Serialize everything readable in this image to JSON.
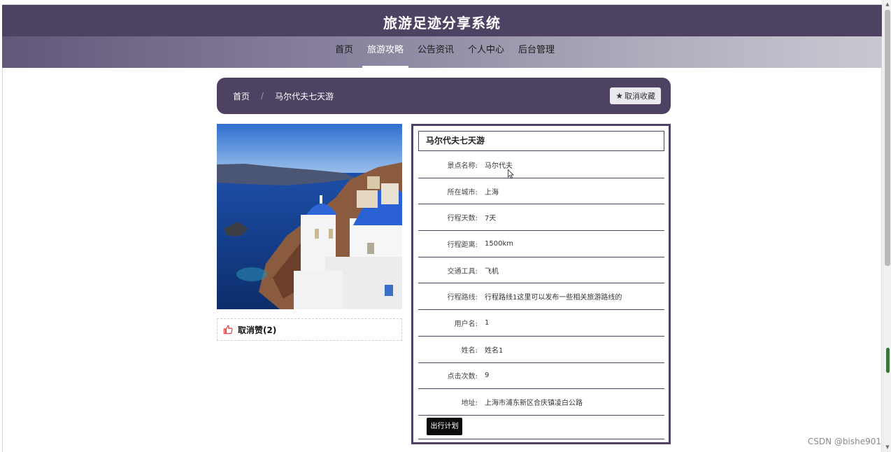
{
  "header": {
    "site_title": "旅游足迹分享系统"
  },
  "nav": {
    "items": [
      {
        "label": "首页",
        "active": false
      },
      {
        "label": "旅游攻略",
        "active": true
      },
      {
        "label": "公告资讯",
        "active": false
      },
      {
        "label": "个人中心",
        "active": false
      },
      {
        "label": "后台管理",
        "active": false
      }
    ]
  },
  "breadcrumb": {
    "home": "首页",
    "separator": "/",
    "current": "马尔代夫七天游"
  },
  "favorite_button": {
    "label": "取消收藏",
    "icon": "star-icon"
  },
  "like": {
    "label": "取消赞(2)",
    "icon": "thumbs-up-icon"
  },
  "detail": {
    "title": "马尔代夫七天游",
    "rows": [
      {
        "label": "景点名称:",
        "value": "马尔代夫"
      },
      {
        "label": "所在城市:",
        "value": "上海"
      },
      {
        "label": "行程天数:",
        "value": "7天"
      },
      {
        "label": "行程距离:",
        "value": "1500km"
      },
      {
        "label": "交通工具:",
        "value": "飞机"
      },
      {
        "label": "行程路线:",
        "value": "行程路线1这里可以发布一些相关旅游路线的"
      },
      {
        "label": "用户名:",
        "value": "1"
      },
      {
        "label": "姓名:",
        "value": "姓名1"
      },
      {
        "label": "点击次数:",
        "value": "9"
      },
      {
        "label": "地址:",
        "value": "上海市浦东新区合庆镇凌白公路"
      }
    ],
    "plan_button": "出行计划"
  },
  "watermark": "CSDN @bishe901",
  "colors": {
    "primary": "#4e4263",
    "like_icon": "#e53935",
    "button_dark": "#0b0b0b"
  }
}
